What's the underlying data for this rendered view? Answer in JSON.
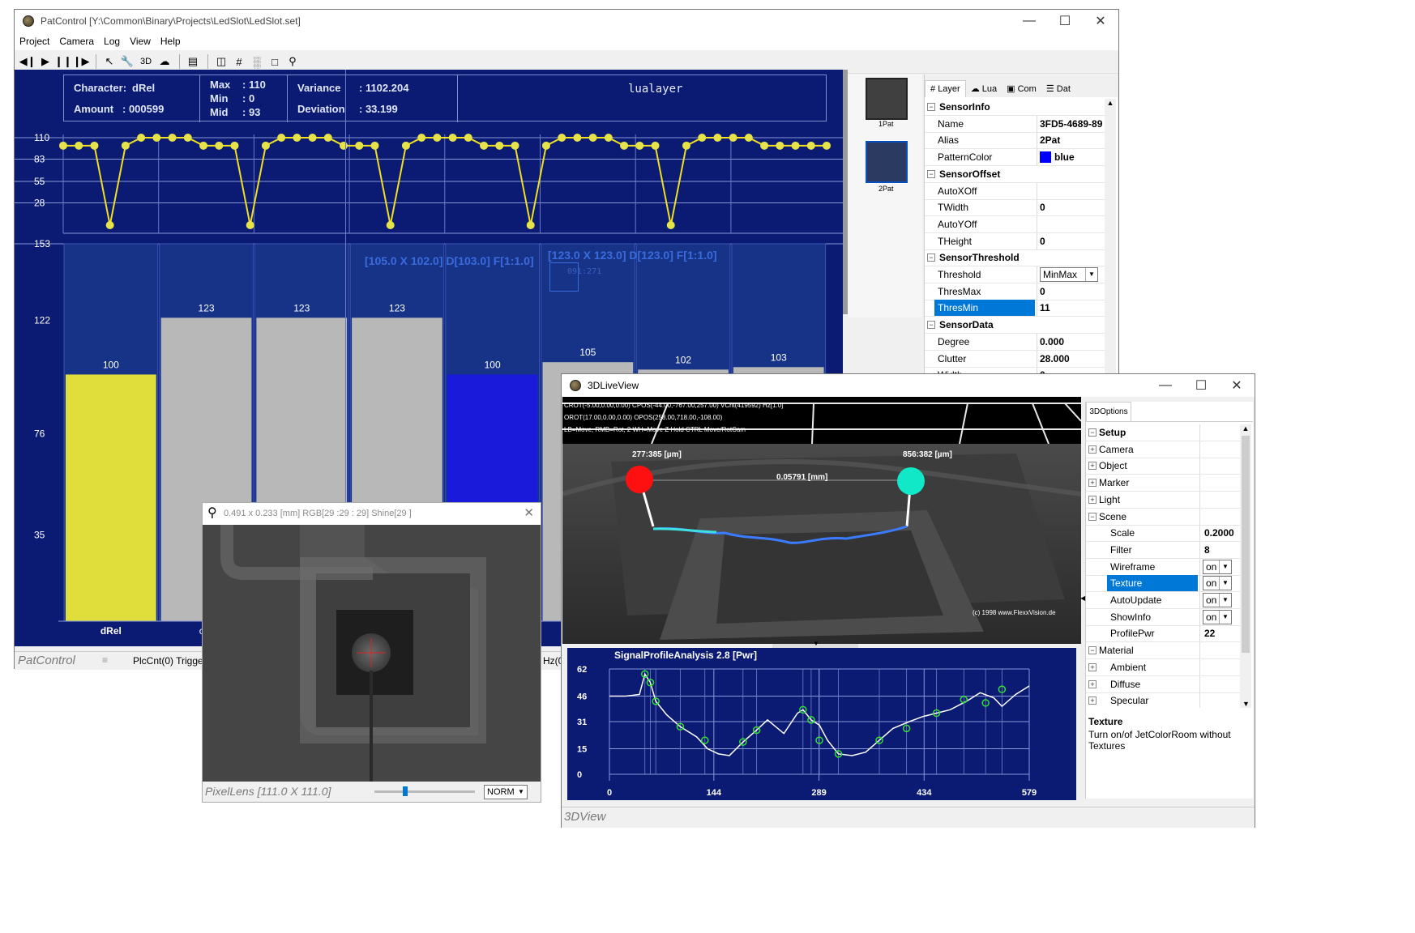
{
  "patcontrol": {
    "title": "PatControl [Y:\\Common\\Binary\\Projects\\LedSlot\\LedSlot.set]",
    "menu": [
      "Project",
      "Camera",
      "Log",
      "View",
      "Help"
    ],
    "info": {
      "character_label": "Character:",
      "character_value": "dRel",
      "amount_label": "Amount",
      "amount_value": ": 000599",
      "max_label": "Max",
      "max_value": ": 110",
      "min_label": "Min",
      "min_value": ": 0",
      "mid_label": "Mid",
      "mid_value": ": 93",
      "variance_label": "Variance",
      "variance_value": ": 1102.204",
      "deviation_label": "Deviation",
      "deviation_value": ": 33.199",
      "layer_name": "lualayer"
    },
    "trend_ticks": [
      "110",
      "83",
      "55",
      "28"
    ],
    "trend_values": [
      100,
      100,
      100,
      0,
      100,
      110,
      110,
      110,
      110,
      100,
      100,
      100,
      0,
      100,
      110,
      110,
      110,
      110,
      100,
      100,
      100,
      0,
      100,
      110,
      110,
      110,
      110,
      100,
      100,
      100,
      0,
      100,
      110,
      110,
      110,
      110,
      100,
      100,
      100,
      0,
      100,
      110,
      110,
      110,
      110,
      100,
      100,
      100,
      100,
      100
    ],
    "bar_ticks": [
      "153",
      "122",
      "76",
      "35"
    ],
    "bars": [
      {
        "label": "100",
        "value": 100,
        "color": "#e0de3a"
      },
      {
        "label": "123",
        "value": 123,
        "color": "#b8b8b8"
      },
      {
        "label": "123",
        "value": 123,
        "color": "#b8b8b8"
      },
      {
        "label": "123",
        "value": 123,
        "color": "#b8b8b8"
      },
      {
        "label": "100",
        "value": 100,
        "color": "#1a1adb"
      },
      {
        "label": "105",
        "value": 105,
        "color": "#b8b8b8"
      },
      {
        "label": "102",
        "value": 102,
        "color": "#b8b8b8"
      },
      {
        "label": "103",
        "value": 103,
        "color": "#b8b8b8"
      }
    ],
    "bar_category_first": "dRel",
    "bar_category_second": "c",
    "overlay1": "[105.0 X 102.0] D[103.0] F[1:1.0]",
    "overlay2": "[123.0 X 123.0] D[123.0] F[1:1.0]",
    "overlay_coord": "091:271",
    "status_name": "PatControl",
    "status_plc": "PlcCnt(0) Trigger(",
    "status_hz": "Hz(0",
    "thumbs": [
      "1Pat",
      "2Pat"
    ]
  },
  "props": {
    "tabs": [
      "Layer",
      "Lua",
      "Com",
      "Dat"
    ],
    "rows": [
      {
        "type": "sec",
        "label": "SensorInfo"
      },
      {
        "type": "row",
        "label": "Name",
        "value": "3FD5-4689-89"
      },
      {
        "type": "row",
        "label": "Alias",
        "value": "2Pat"
      },
      {
        "type": "color",
        "label": "PatternColor",
        "value": "blue",
        "swatch": "#0000ff"
      },
      {
        "type": "sec",
        "label": "SensorOffset"
      },
      {
        "type": "row",
        "label": "AutoXOff",
        "value": ""
      },
      {
        "type": "row",
        "label": "TWidth",
        "value": "0"
      },
      {
        "type": "row",
        "label": "AutoYOff",
        "value": ""
      },
      {
        "type": "row",
        "label": "THeight",
        "value": "0"
      },
      {
        "type": "sec",
        "label": "SensorThreshold"
      },
      {
        "type": "dd",
        "label": "Threshold",
        "value": "MinMax"
      },
      {
        "type": "row",
        "label": "ThresMax",
        "value": "0"
      },
      {
        "type": "sel",
        "label": "ThresMin",
        "value": "11"
      },
      {
        "type": "sec",
        "label": "SensorData"
      },
      {
        "type": "row",
        "label": "Degree",
        "value": "0.000"
      },
      {
        "type": "row",
        "label": "Clutter",
        "value": "28.000"
      },
      {
        "type": "row",
        "label": "Width",
        "value": "0"
      }
    ]
  },
  "pixellens": {
    "title": "0.491 x 0.233 [mm] RGB[29 :29 : 29] Shine[29 ]",
    "status": "PixelLens  [111.0 X 111.0]",
    "mode": "NORM",
    "slider_value": 0.28
  },
  "live3d": {
    "title": "3DLiveView",
    "hud1": "CROT(-5.00,0.00,0.00) CPOS(-44.00,-767.00,257.00) VCnt(419592) Hz[1.0]",
    "hud2": "OROT(17.00,0.00,0.00) OPOS(258.00,718.00,-108.00)",
    "hud3": "LB=Move, RMB=Rot, 2 WH=Move Z Hold CTRL Move/RotCam",
    "marker_left": "277:385 [µm]",
    "marker_right": "856:382 [µm]",
    "distance": "0.05791 [mm]",
    "copyright": "(c) 1998 www.FlexxVision.de",
    "status": "3DView",
    "profile": {
      "title": "SignalProfileAnalysis 2.8 [Pwr]",
      "y_ticks": [
        "62",
        "46",
        "31",
        "15",
        "0"
      ],
      "x_ticks": [
        "0",
        "144",
        "289",
        "434",
        "579"
      ],
      "points": [
        [
          0,
          46
        ],
        [
          30,
          46
        ],
        [
          55,
          47
        ],
        [
          65,
          59
        ],
        [
          75,
          54
        ],
        [
          85,
          43
        ],
        [
          105,
          35
        ],
        [
          130,
          28
        ],
        [
          160,
          22
        ],
        [
          180,
          15
        ],
        [
          200,
          12
        ],
        [
          220,
          11
        ],
        [
          245,
          19
        ],
        [
          270,
          26
        ],
        [
          290,
          32
        ],
        [
          305,
          28
        ],
        [
          320,
          24
        ],
        [
          345,
          36
        ],
        [
          355,
          38
        ],
        [
          370,
          32
        ],
        [
          385,
          29
        ],
        [
          400,
          20
        ],
        [
          420,
          12
        ],
        [
          445,
          11
        ],
        [
          470,
          13
        ],
        [
          495,
          20
        ],
        [
          520,
          27
        ],
        [
          550,
          31
        ],
        [
          575,
          34
        ],
        [
          600,
          36
        ],
        [
          625,
          38
        ],
        [
          655,
          43
        ],
        [
          680,
          48
        ],
        [
          705,
          45
        ],
        [
          720,
          40
        ],
        [
          745,
          47
        ],
        [
          770,
          52
        ]
      ],
      "circles": [
        [
          65,
          59
        ],
        [
          75,
          54
        ],
        [
          85,
          43
        ],
        [
          130,
          28
        ],
        [
          175,
          20
        ],
        [
          245,
          19
        ],
        [
          270,
          26
        ],
        [
          355,
          38
        ],
        [
          370,
          32
        ],
        [
          385,
          20
        ],
        [
          420,
          12
        ],
        [
          495,
          20
        ],
        [
          545,
          27
        ],
        [
          600,
          36
        ],
        [
          650,
          44
        ],
        [
          690,
          42
        ],
        [
          720,
          50
        ]
      ]
    }
  },
  "options3d": {
    "tab": "3DOptions",
    "rows": [
      {
        "type": "sec",
        "label": "Setup",
        "sign": "⊟"
      },
      {
        "type": "exp",
        "label": "Camera"
      },
      {
        "type": "exp",
        "label": "Object"
      },
      {
        "type": "exp",
        "label": "Marker"
      },
      {
        "type": "exp",
        "label": "Light"
      },
      {
        "type": "expo",
        "label": "Scene"
      },
      {
        "type": "row",
        "label": "Scale",
        "value": "0.2000"
      },
      {
        "type": "row",
        "label": "Filter",
        "value": "8"
      },
      {
        "type": "dd",
        "label": "Wireframe",
        "value": "on"
      },
      {
        "type": "seldd",
        "label": "Texture",
        "value": "on"
      },
      {
        "type": "dd",
        "label": "AutoUpdate",
        "value": "on"
      },
      {
        "type": "dd",
        "label": "ShowInfo",
        "value": "on"
      },
      {
        "type": "row",
        "label": "ProfilePwr",
        "value": "22"
      },
      {
        "type": "expo",
        "label": "Material"
      },
      {
        "type": "exp2",
        "label": "Ambient"
      },
      {
        "type": "exp2",
        "label": "Diffuse"
      },
      {
        "type": "exp2",
        "label": "Specular"
      }
    ],
    "help_title": "Texture",
    "help_text": "Turn on/of JetColorRoom without Textures"
  }
}
